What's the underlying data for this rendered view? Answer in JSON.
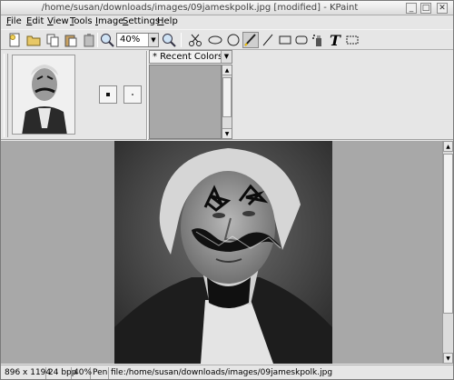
{
  "window": {
    "title": "/home/susan/downloads/images/09jameskpolk.jpg [modified] - KPaint",
    "buttons": {
      "minimize": "_",
      "maximize": "□",
      "close": "✕"
    }
  },
  "menu": {
    "items": [
      {
        "label": "File",
        "u": "F",
        "rest": "ile"
      },
      {
        "label": "Edit",
        "u": "E",
        "rest": "dit"
      },
      {
        "label": "View",
        "u": "V",
        "rest": "iew"
      },
      {
        "label": "Tools",
        "u": "T",
        "rest": "ools"
      },
      {
        "label": "Image",
        "u": "I",
        "rest": "mage"
      },
      {
        "label": "Settings",
        "u": "S",
        "rest": "ettings"
      },
      {
        "label": "Help",
        "u": "H",
        "rest": "elp"
      }
    ]
  },
  "toolbar": {
    "zoom_value": "40%",
    "icons": [
      "new-document-icon",
      "open-folder-icon",
      "copy-icon",
      "paste-icon",
      "clipboard-icon",
      "zoom-in-icon",
      "zoom-out-icon",
      "scissors-icon",
      "ellipse-icon",
      "circle-icon",
      "pen-icon",
      "line-icon",
      "rectangle-icon",
      "rounded-rectangle-icon",
      "spray-can-icon",
      "text-icon",
      "selection-rectangle-icon"
    ]
  },
  "tool_panel": {
    "recent_colors_label": "* Recent Colors *",
    "recent_colors": []
  },
  "status": {
    "dimensions": "896 x 1194",
    "depth": "24 bpp",
    "zoom": "40%",
    "tool": "Pen",
    "file": "file:/home/susan/downloads/images/09jameskpolk.jpg"
  },
  "colors": {
    "canvas_background": "#a8a8a8",
    "window_background": "#e6e6e6",
    "scribble": "#111111"
  }
}
